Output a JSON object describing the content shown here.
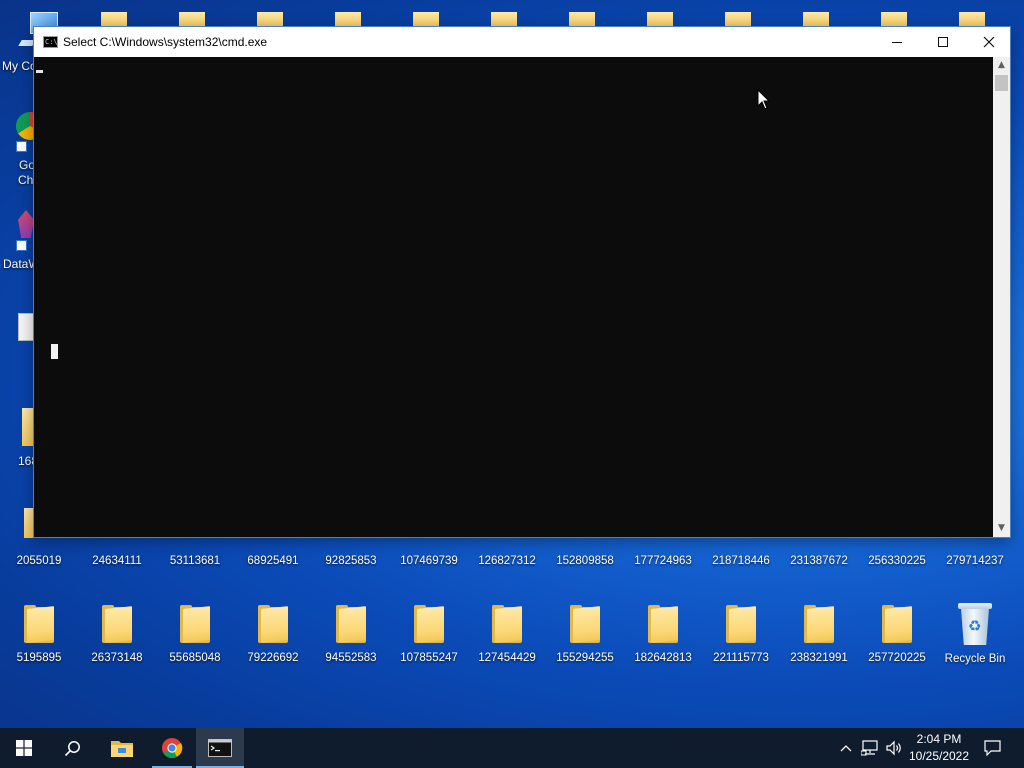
{
  "desktop": {
    "left_labels": [
      "My Co",
      "Go",
      "Ch",
      "DataW",
      "168"
    ],
    "row1_folders": [
      "2055019",
      "24634111",
      "53113681",
      "68925491",
      "92825853",
      "107469739",
      "126827312",
      "152809858",
      "177724963",
      "218718446",
      "231387672",
      "256330225",
      "279714237"
    ],
    "row2_folders": [
      "5195895",
      "26373148",
      "55685048",
      "79226692",
      "94552583",
      "107855247",
      "127454429",
      "155294255",
      "182642813",
      "221115773",
      "238321991",
      "257720225"
    ],
    "recycle_bin": "Recycle Bin"
  },
  "window": {
    "title": "Select C:\\Windows\\system32\\cmd.exe",
    "icon_glyph": "C:\\_",
    "console_bg": "#0c0c0c"
  },
  "taskbar": {
    "bg": "#0f1c2e",
    "time": "2:04 PM",
    "date": "10/25/2022",
    "items": [
      "start-icon",
      "search-icon",
      "file-explorer-icon",
      "chrome-icon",
      "cmd-icon"
    ]
  },
  "colors": {
    "folder": "#fbd775",
    "accent": "#7cb1e6",
    "desktop_blue": "#1565d4"
  }
}
